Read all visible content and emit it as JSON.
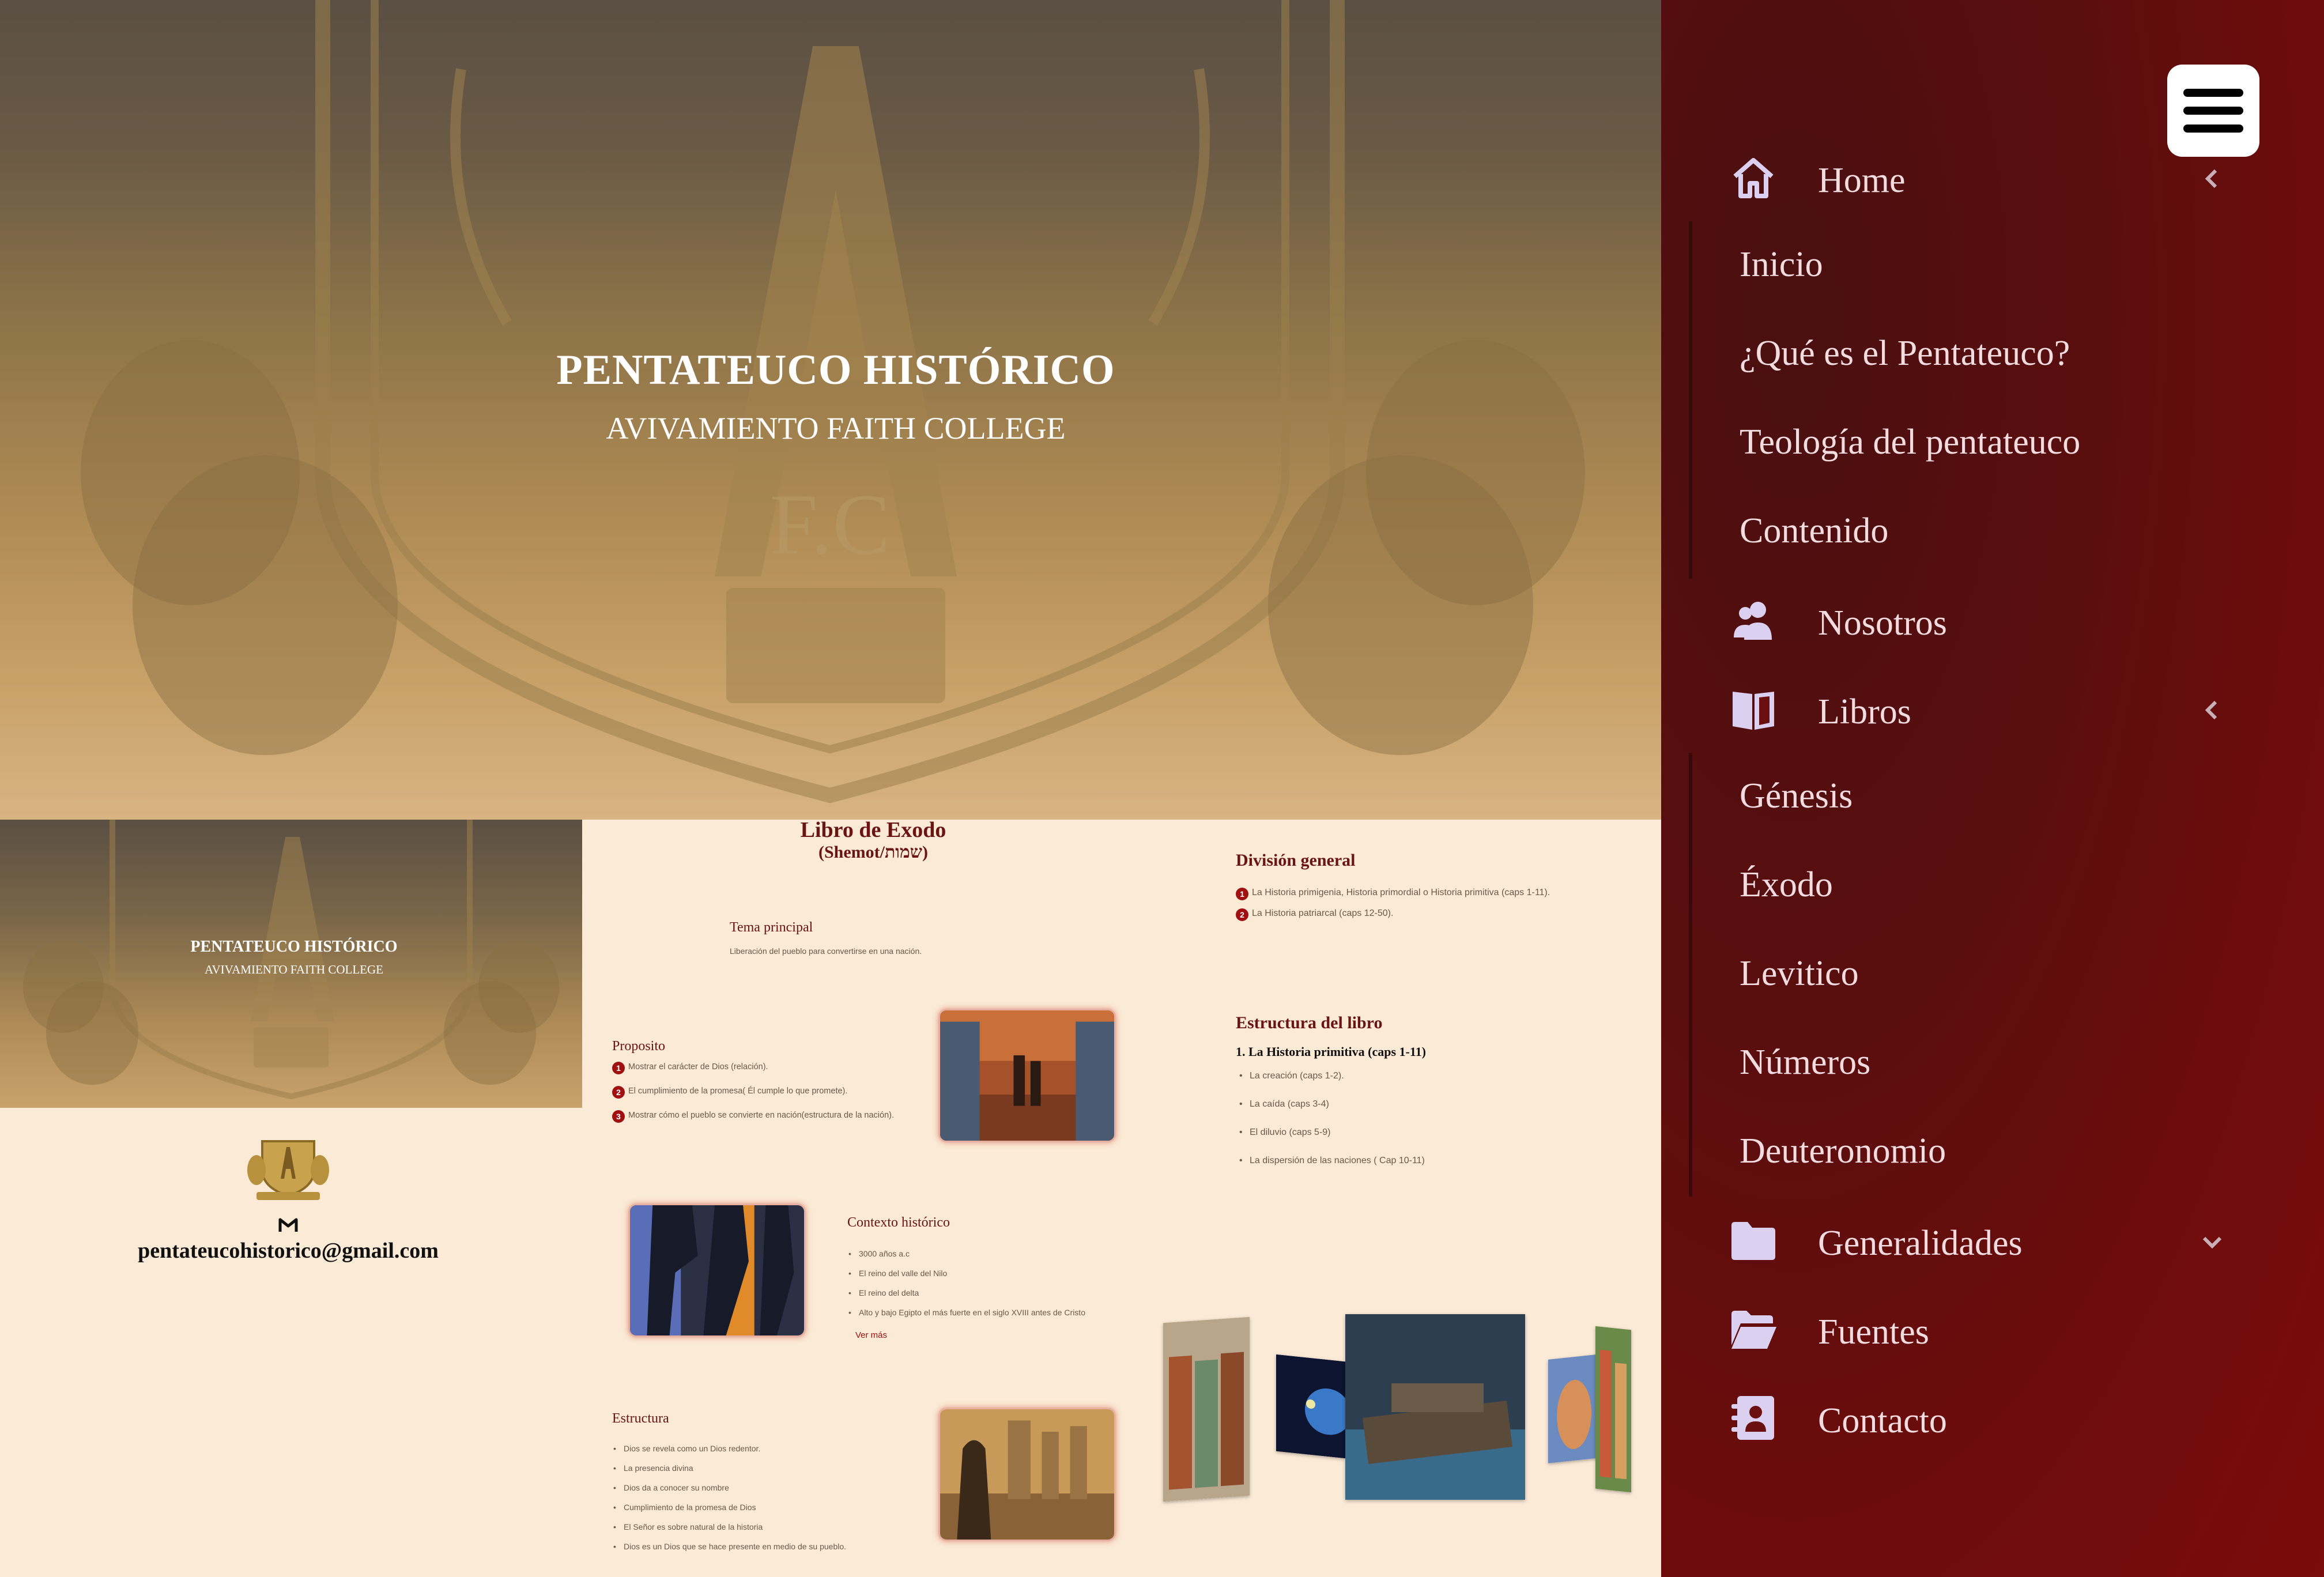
{
  "hero": {
    "title": "PENTATEUCO HISTÓRICO",
    "subtitle": "AVIVAMIENTO FAITH COLLEGE",
    "crest_text": "F.C"
  },
  "left_card": {
    "title": "PENTATEUCO HISTÓRICO",
    "subtitle": "AVIVAMIENTO FAITH COLLEGE",
    "email": "pentateucohistorico@gmail.com",
    "email_icon": "gmail-icon"
  },
  "content": {
    "title": "Libro de Exodo",
    "subtitle": "(Shemot/שמות)",
    "tema": {
      "heading": "Tema principal",
      "text": "Liberación del pueblo para convertirse en una nación."
    },
    "proposito": {
      "heading": "Proposito",
      "items": [
        {
          "n": "1",
          "text": "Mostrar el carácter de Dios (relación)."
        },
        {
          "n": "2",
          "text": "El cumplimiento de la promesa( Él cumple lo que promete)."
        },
        {
          "n": "3",
          "text": "Mostrar cómo el pueblo se convierte en nación(estructura de la nación)."
        }
      ]
    },
    "contexto": {
      "heading": "Contexto histórico",
      "items": [
        "3000 años a.c",
        "El reino del valle del Nilo",
        "El reino del delta",
        "Alto y bajo Egipto el más fuerte en el siglo XVIII antes de Cristo"
      ],
      "link": "Ver más"
    },
    "estructura": {
      "heading": "Estructura",
      "items": [
        "Dios se revela como un Dios redentor.",
        "La presencia divina",
        "Dios da a conocer su nombre",
        "Cumplimiento de la promesa de Dios",
        "El Señor es sobre natural de la historia",
        "Dios es un Dios que se hace presente en medio de su pueblo."
      ]
    }
  },
  "right": {
    "division": {
      "heading": "División general",
      "items": [
        {
          "n": "1",
          "text": "La Historia primigenia, Historia primordial o Historia primitiva (caps 1-11)."
        },
        {
          "n": "2",
          "text": "La Historia patriarcal (caps 12-50)."
        }
      ]
    },
    "estructura_libro": {
      "heading": "Estructura del libro",
      "sub": "1. La Historia primitiva (caps 1-11)",
      "items": [
        "La creación (caps 1-2).",
        "La caída (caps 3-4)",
        "El diluvio (caps 5-9)",
        "La dispersión de las naciones ( Cap 10-11)"
      ]
    }
  },
  "sidebar": {
    "menu_icon": "hamburger-icon",
    "items": [
      {
        "label": "Home",
        "icon": "home-icon",
        "chevron": "chevron-left-icon"
      },
      {
        "label": "Nosotros",
        "icon": "users-icon"
      },
      {
        "label": "Libros",
        "icon": "book-icon",
        "chevron": "chevron-left-icon"
      },
      {
        "label": "Generalidades",
        "icon": "folder-icon",
        "chevron": "chevron-down-icon"
      },
      {
        "label": "Fuentes",
        "icon": "folder-open-icon"
      },
      {
        "label": "Contacto",
        "icon": "contact-card-icon"
      }
    ],
    "home_sub": [
      "Inicio",
      "¿Qué es el Pentateuco?",
      "Teología del pentateuco",
      "Contenido"
    ],
    "libros_sub": [
      "Génesis",
      "Éxodo",
      "Levitico",
      "Números",
      "Deuteronomio"
    ]
  }
}
